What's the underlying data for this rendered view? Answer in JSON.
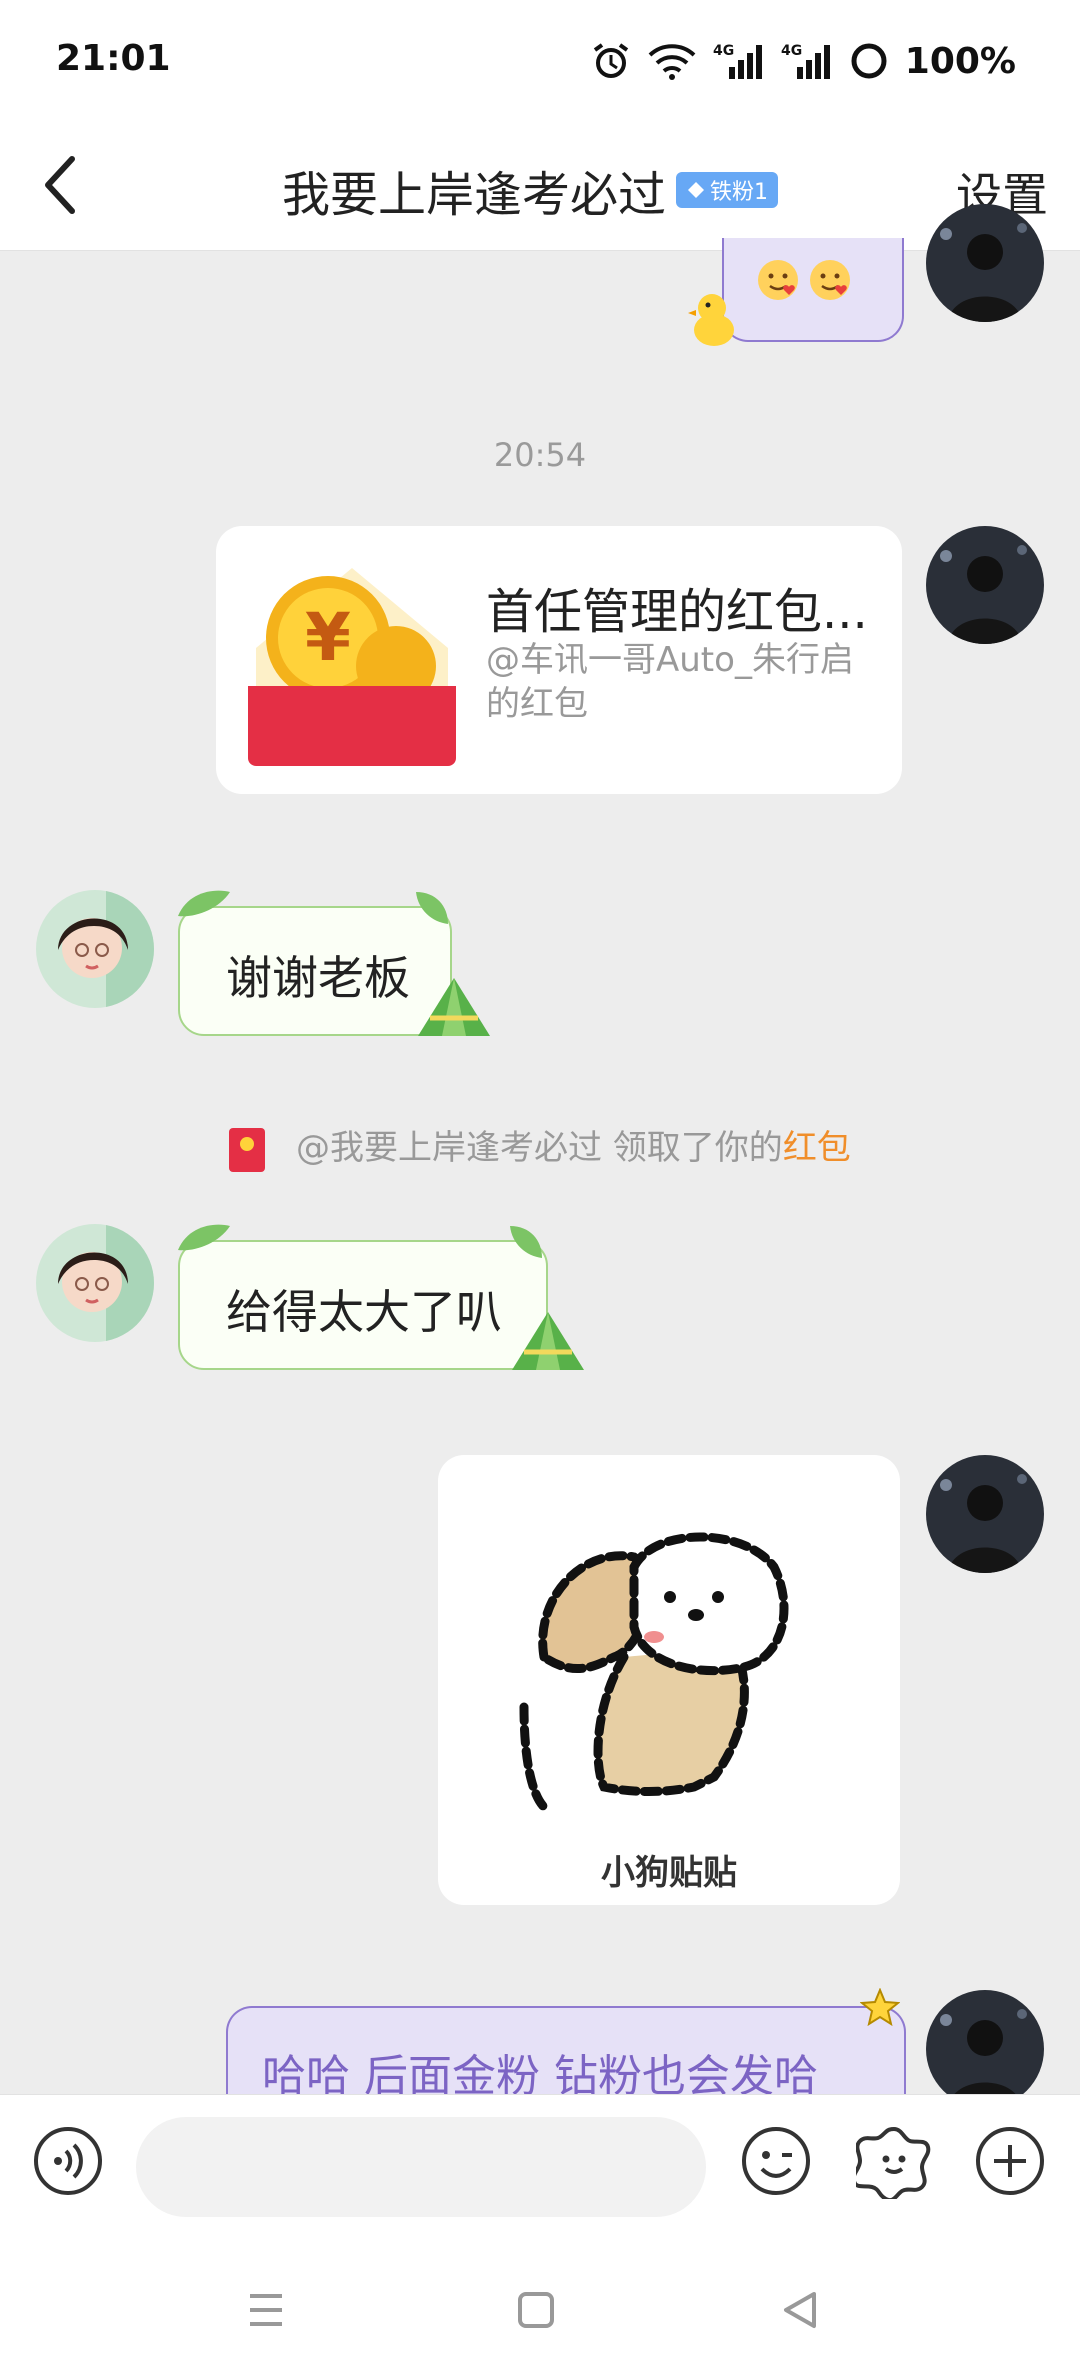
{
  "status_bar": {
    "time": "21:01",
    "battery": "100%",
    "network": "4G",
    "icons": [
      "alarm-icon",
      "wifi-icon",
      "signal-4g-icon",
      "signal-4g-icon",
      "battery-icon"
    ]
  },
  "header": {
    "back_icon": "chevron-left-icon",
    "title": "我要上岸逢考必过",
    "badge": "铁粉1",
    "settings": "设置"
  },
  "messages": {
    "time_divider": "20:54",
    "red_packet": {
      "title": "首任管理的红包...",
      "subtitle": "@车讯一哥Auto_朱行启的红包"
    },
    "reply1": "谢谢老板",
    "notice_prefix": "@我要上岸逢考必过 领取了你的",
    "notice_link": "红包",
    "reply2": "给得太大了叭",
    "sticker_caption": "小狗贴贴",
    "last_message": "哈哈 后面金粉 钻粉也会发哈"
  },
  "input_bar": {
    "placeholder": "",
    "icons": [
      "voice-icon",
      "emoji-icon",
      "sticker-icon",
      "plus-icon"
    ]
  },
  "nav_bar": {
    "icons": [
      "menu-icon",
      "home-icon",
      "back-triangle-icon"
    ]
  },
  "colors": {
    "background": "#ededed",
    "accent_orange": "#f08e2a",
    "green_border": "#a6d68a",
    "purple_border": "#8f7ad0",
    "badge_blue": "#67a8f5"
  }
}
